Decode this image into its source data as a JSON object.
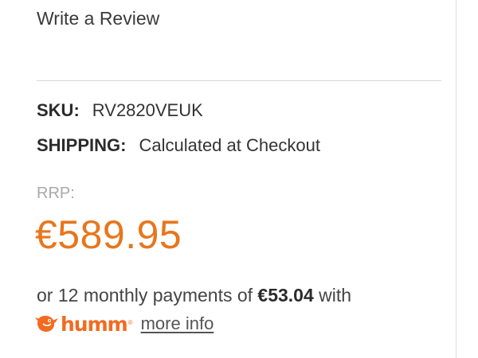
{
  "review": {
    "link_label": "Write a Review"
  },
  "details": {
    "sku_label": "SKU:",
    "sku_value": "RV2820VEUK",
    "shipping_label": "SHIPPING:",
    "shipping_value": "Calculated at Checkout"
  },
  "pricing": {
    "rrp_label": "RRP:",
    "price": "€589.95",
    "price_color": "#e8761c"
  },
  "finance": {
    "monthly_prefix": "or 12 monthly payments of",
    "monthly_amount": "€53.04",
    "monthly_suffix": "with",
    "provider_icon": "humm-bird-logo-icon",
    "provider_name": "humm",
    "provider_reg": "®",
    "provider_color": "#f26b21",
    "more_info_label": "more info"
  }
}
